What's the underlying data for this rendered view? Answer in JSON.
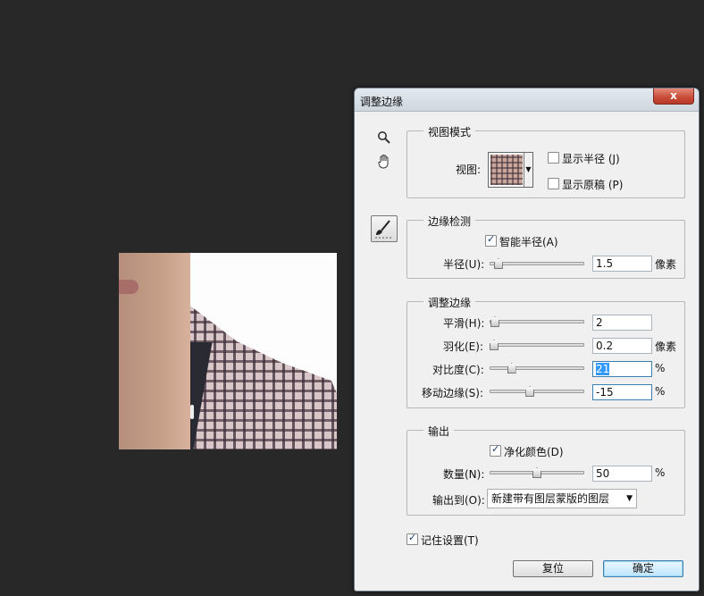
{
  "dialog": {
    "title": "调整边缘",
    "close_label": "x"
  },
  "view_mode": {
    "legend": "视图模式",
    "view_label": "视图:",
    "show_radius": {
      "label": "显示半径 (J)",
      "checked": false
    },
    "show_original": {
      "label": "显示原稿 (P)",
      "checked": false
    }
  },
  "edge_detection": {
    "legend": "边缘检测",
    "smart_radius": {
      "label": "智能半径(A)",
      "checked": true
    },
    "radius": {
      "label": "半径(U):",
      "value": "1.5",
      "unit": "像素",
      "slider": 0.06
    }
  },
  "adjust_edge": {
    "legend": "调整边缘",
    "smooth": {
      "label": "平滑(H):",
      "value": "2",
      "unit": "",
      "slider": 0.02
    },
    "feather": {
      "label": "羽化(E):",
      "value": "0.2",
      "unit": "像素",
      "slider": 0.01
    },
    "contrast": {
      "label": "对比度(C):",
      "value": "21",
      "unit": "%",
      "slider": 0.21
    },
    "shift_edge": {
      "label": "移动边缘(S):",
      "value": "-15",
      "unit": "%",
      "slider": 0.42
    }
  },
  "output": {
    "legend": "输出",
    "decontaminate": {
      "label": "净化颜色(D)",
      "checked": true
    },
    "amount": {
      "label": "数量(N):",
      "value": "50",
      "unit": "%",
      "slider": 0.5
    },
    "output_to_label": "输出到(O):",
    "output_to_value": "新建带有图层蒙版的图层"
  },
  "remember": {
    "label": "记住设置(T)",
    "checked": true
  },
  "buttons": {
    "reset": "复位",
    "ok": "确定"
  },
  "icons": {
    "zoom": "zoom-icon",
    "hand": "hand-icon",
    "refine_radius": "refine-radius-brush-icon"
  }
}
